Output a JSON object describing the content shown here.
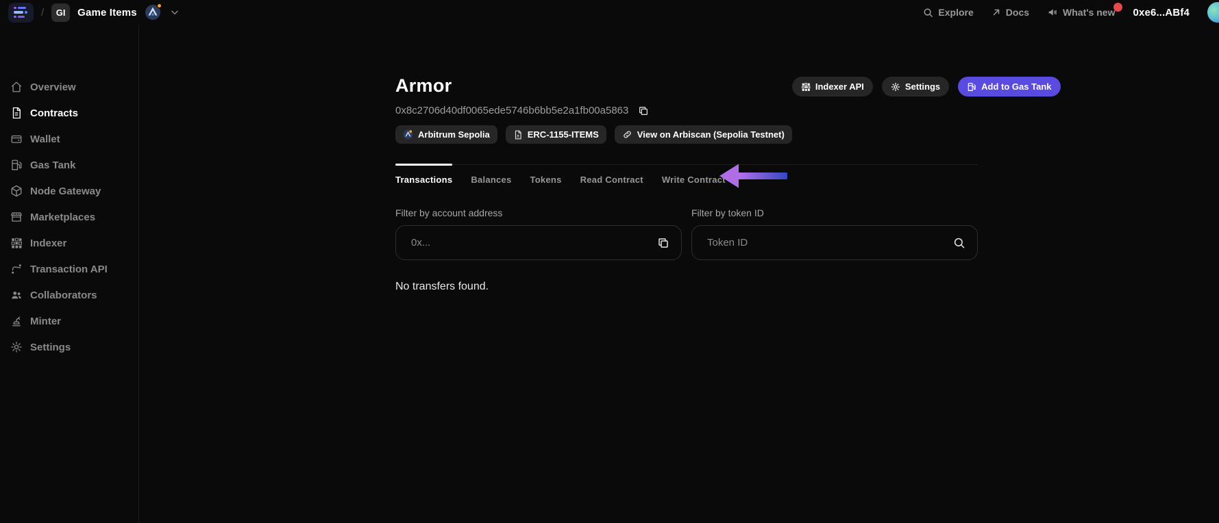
{
  "navbar": {
    "separator": "/",
    "org_avatar": "GI",
    "project_name": "Game Items",
    "explore_label": "Explore",
    "docs_label": "Docs",
    "whats_new_label": "What's new",
    "wallet_address": "0xe6...ABf4"
  },
  "sidebar": {
    "items": [
      {
        "label": "Overview",
        "icon": "home-icon"
      },
      {
        "label": "Contracts",
        "icon": "contract-icon",
        "active": true
      },
      {
        "label": "Wallet",
        "icon": "wallet-icon"
      },
      {
        "label": "Gas Tank",
        "icon": "gas-pump-icon"
      },
      {
        "label": "Node Gateway",
        "icon": "cube-icon"
      },
      {
        "label": "Marketplaces",
        "icon": "storefront-icon"
      },
      {
        "label": "Indexer",
        "icon": "grid-icon"
      },
      {
        "label": "Transaction API",
        "icon": "route-icon"
      },
      {
        "label": "Collaborators",
        "icon": "users-icon"
      },
      {
        "label": "Minter",
        "icon": "stamp-icon"
      },
      {
        "label": "Settings",
        "icon": "gear-icon"
      }
    ]
  },
  "main": {
    "title": "Armor",
    "contract_address": "0x8c2706d40df0065ede5746b6bb5e2a1fb00a5863",
    "badges": [
      {
        "label": "Arbitrum Sepolia",
        "icon": "arbitrum-network-icon"
      },
      {
        "label": "ERC-1155-ITEMS",
        "icon": "document-icon"
      },
      {
        "label": "View on Arbiscan (Sepolia Testnet)",
        "icon": "link-icon"
      }
    ],
    "actions": [
      {
        "label": "Indexer API",
        "icon": "grid-icon"
      },
      {
        "label": "Settings",
        "icon": "gear-icon"
      },
      {
        "label": "Add to Gas Tank",
        "icon": "gas-pump-icon",
        "accent": true
      }
    ],
    "tabs": [
      {
        "label": "Transactions",
        "active": true
      },
      {
        "label": "Balances"
      },
      {
        "label": "Tokens"
      },
      {
        "label": "Read Contract"
      },
      {
        "label": "Write Contract"
      }
    ],
    "filters": {
      "account": {
        "label": "Filter by account address",
        "placeholder": "0x...",
        "icon": "copy-icon"
      },
      "token": {
        "label": "Filter by token ID",
        "placeholder": "Token ID",
        "icon": "search-icon"
      }
    },
    "empty_state": "No transfers found."
  },
  "annotation": {
    "type": "arrow-pointing-left-at-write-contract-tab"
  },
  "colors": {
    "accent_purple": "#5a4be0",
    "arrow_gradient_start": "#b873e9",
    "arrow_gradient_end": "#3447c4",
    "notification_red": "#e5484d",
    "notification_orange": "#f2a33c",
    "badge_bg": "#262626",
    "page_bg": "#0a0a0a"
  }
}
